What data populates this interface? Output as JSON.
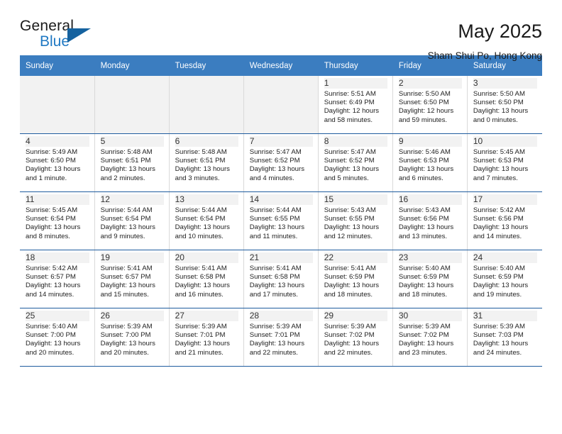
{
  "brand": {
    "name_top": "General",
    "name_bottom": "Blue",
    "triangle_color": "#15629f",
    "blue_color": "#2079c3"
  },
  "header": {
    "title": "May 2025",
    "subtitle": "Sham Shui Po, Hong Kong"
  },
  "colors": {
    "header_row_bg": "#3b7dc0",
    "header_row_text": "#ffffff",
    "cell_shade": "#f2f2f2",
    "row_border": "#1f5c9e"
  },
  "weekday_headers": [
    "Sunday",
    "Monday",
    "Tuesday",
    "Wednesday",
    "Thursday",
    "Friday",
    "Saturday"
  ],
  "weeks": [
    [
      {
        "blank": true
      },
      {
        "blank": true
      },
      {
        "blank": true
      },
      {
        "blank": true
      },
      {
        "day": "1",
        "sunrise": "Sunrise: 5:51 AM",
        "sunset": "Sunset: 6:49 PM",
        "daylight1": "Daylight: 12 hours",
        "daylight2": "and 58 minutes."
      },
      {
        "day": "2",
        "sunrise": "Sunrise: 5:50 AM",
        "sunset": "Sunset: 6:50 PM",
        "daylight1": "Daylight: 12 hours",
        "daylight2": "and 59 minutes."
      },
      {
        "day": "3",
        "sunrise": "Sunrise: 5:50 AM",
        "sunset": "Sunset: 6:50 PM",
        "daylight1": "Daylight: 13 hours",
        "daylight2": "and 0 minutes."
      }
    ],
    [
      {
        "day": "4",
        "sunrise": "Sunrise: 5:49 AM",
        "sunset": "Sunset: 6:50 PM",
        "daylight1": "Daylight: 13 hours",
        "daylight2": "and 1 minute."
      },
      {
        "day": "5",
        "sunrise": "Sunrise: 5:48 AM",
        "sunset": "Sunset: 6:51 PM",
        "daylight1": "Daylight: 13 hours",
        "daylight2": "and 2 minutes."
      },
      {
        "day": "6",
        "sunrise": "Sunrise: 5:48 AM",
        "sunset": "Sunset: 6:51 PM",
        "daylight1": "Daylight: 13 hours",
        "daylight2": "and 3 minutes."
      },
      {
        "day": "7",
        "sunrise": "Sunrise: 5:47 AM",
        "sunset": "Sunset: 6:52 PM",
        "daylight1": "Daylight: 13 hours",
        "daylight2": "and 4 minutes."
      },
      {
        "day": "8",
        "sunrise": "Sunrise: 5:47 AM",
        "sunset": "Sunset: 6:52 PM",
        "daylight1": "Daylight: 13 hours",
        "daylight2": "and 5 minutes."
      },
      {
        "day": "9",
        "sunrise": "Sunrise: 5:46 AM",
        "sunset": "Sunset: 6:53 PM",
        "daylight1": "Daylight: 13 hours",
        "daylight2": "and 6 minutes."
      },
      {
        "day": "10",
        "sunrise": "Sunrise: 5:45 AM",
        "sunset": "Sunset: 6:53 PM",
        "daylight1": "Daylight: 13 hours",
        "daylight2": "and 7 minutes."
      }
    ],
    [
      {
        "day": "11",
        "sunrise": "Sunrise: 5:45 AM",
        "sunset": "Sunset: 6:54 PM",
        "daylight1": "Daylight: 13 hours",
        "daylight2": "and 8 minutes."
      },
      {
        "day": "12",
        "sunrise": "Sunrise: 5:44 AM",
        "sunset": "Sunset: 6:54 PM",
        "daylight1": "Daylight: 13 hours",
        "daylight2": "and 9 minutes."
      },
      {
        "day": "13",
        "sunrise": "Sunrise: 5:44 AM",
        "sunset": "Sunset: 6:54 PM",
        "daylight1": "Daylight: 13 hours",
        "daylight2": "and 10 minutes."
      },
      {
        "day": "14",
        "sunrise": "Sunrise: 5:44 AM",
        "sunset": "Sunset: 6:55 PM",
        "daylight1": "Daylight: 13 hours",
        "daylight2": "and 11 minutes."
      },
      {
        "day": "15",
        "sunrise": "Sunrise: 5:43 AM",
        "sunset": "Sunset: 6:55 PM",
        "daylight1": "Daylight: 13 hours",
        "daylight2": "and 12 minutes."
      },
      {
        "day": "16",
        "sunrise": "Sunrise: 5:43 AM",
        "sunset": "Sunset: 6:56 PM",
        "daylight1": "Daylight: 13 hours",
        "daylight2": "and 13 minutes."
      },
      {
        "day": "17",
        "sunrise": "Sunrise: 5:42 AM",
        "sunset": "Sunset: 6:56 PM",
        "daylight1": "Daylight: 13 hours",
        "daylight2": "and 14 minutes."
      }
    ],
    [
      {
        "day": "18",
        "sunrise": "Sunrise: 5:42 AM",
        "sunset": "Sunset: 6:57 PM",
        "daylight1": "Daylight: 13 hours",
        "daylight2": "and 14 minutes."
      },
      {
        "day": "19",
        "sunrise": "Sunrise: 5:41 AM",
        "sunset": "Sunset: 6:57 PM",
        "daylight1": "Daylight: 13 hours",
        "daylight2": "and 15 minutes."
      },
      {
        "day": "20",
        "sunrise": "Sunrise: 5:41 AM",
        "sunset": "Sunset: 6:58 PM",
        "daylight1": "Daylight: 13 hours",
        "daylight2": "and 16 minutes."
      },
      {
        "day": "21",
        "sunrise": "Sunrise: 5:41 AM",
        "sunset": "Sunset: 6:58 PM",
        "daylight1": "Daylight: 13 hours",
        "daylight2": "and 17 minutes."
      },
      {
        "day": "22",
        "sunrise": "Sunrise: 5:41 AM",
        "sunset": "Sunset: 6:59 PM",
        "daylight1": "Daylight: 13 hours",
        "daylight2": "and 18 minutes."
      },
      {
        "day": "23",
        "sunrise": "Sunrise: 5:40 AM",
        "sunset": "Sunset: 6:59 PM",
        "daylight1": "Daylight: 13 hours",
        "daylight2": "and 18 minutes."
      },
      {
        "day": "24",
        "sunrise": "Sunrise: 5:40 AM",
        "sunset": "Sunset: 6:59 PM",
        "daylight1": "Daylight: 13 hours",
        "daylight2": "and 19 minutes."
      }
    ],
    [
      {
        "day": "25",
        "sunrise": "Sunrise: 5:40 AM",
        "sunset": "Sunset: 7:00 PM",
        "daylight1": "Daylight: 13 hours",
        "daylight2": "and 20 minutes."
      },
      {
        "day": "26",
        "sunrise": "Sunrise: 5:39 AM",
        "sunset": "Sunset: 7:00 PM",
        "daylight1": "Daylight: 13 hours",
        "daylight2": "and 20 minutes."
      },
      {
        "day": "27",
        "sunrise": "Sunrise: 5:39 AM",
        "sunset": "Sunset: 7:01 PM",
        "daylight1": "Daylight: 13 hours",
        "daylight2": "and 21 minutes."
      },
      {
        "day": "28",
        "sunrise": "Sunrise: 5:39 AM",
        "sunset": "Sunset: 7:01 PM",
        "daylight1": "Daylight: 13 hours",
        "daylight2": "and 22 minutes."
      },
      {
        "day": "29",
        "sunrise": "Sunrise: 5:39 AM",
        "sunset": "Sunset: 7:02 PM",
        "daylight1": "Daylight: 13 hours",
        "daylight2": "and 22 minutes."
      },
      {
        "day": "30",
        "sunrise": "Sunrise: 5:39 AM",
        "sunset": "Sunset: 7:02 PM",
        "daylight1": "Daylight: 13 hours",
        "daylight2": "and 23 minutes."
      },
      {
        "day": "31",
        "sunrise": "Sunrise: 5:39 AM",
        "sunset": "Sunset: 7:03 PM",
        "daylight1": "Daylight: 13 hours",
        "daylight2": "and 24 minutes."
      }
    ]
  ]
}
